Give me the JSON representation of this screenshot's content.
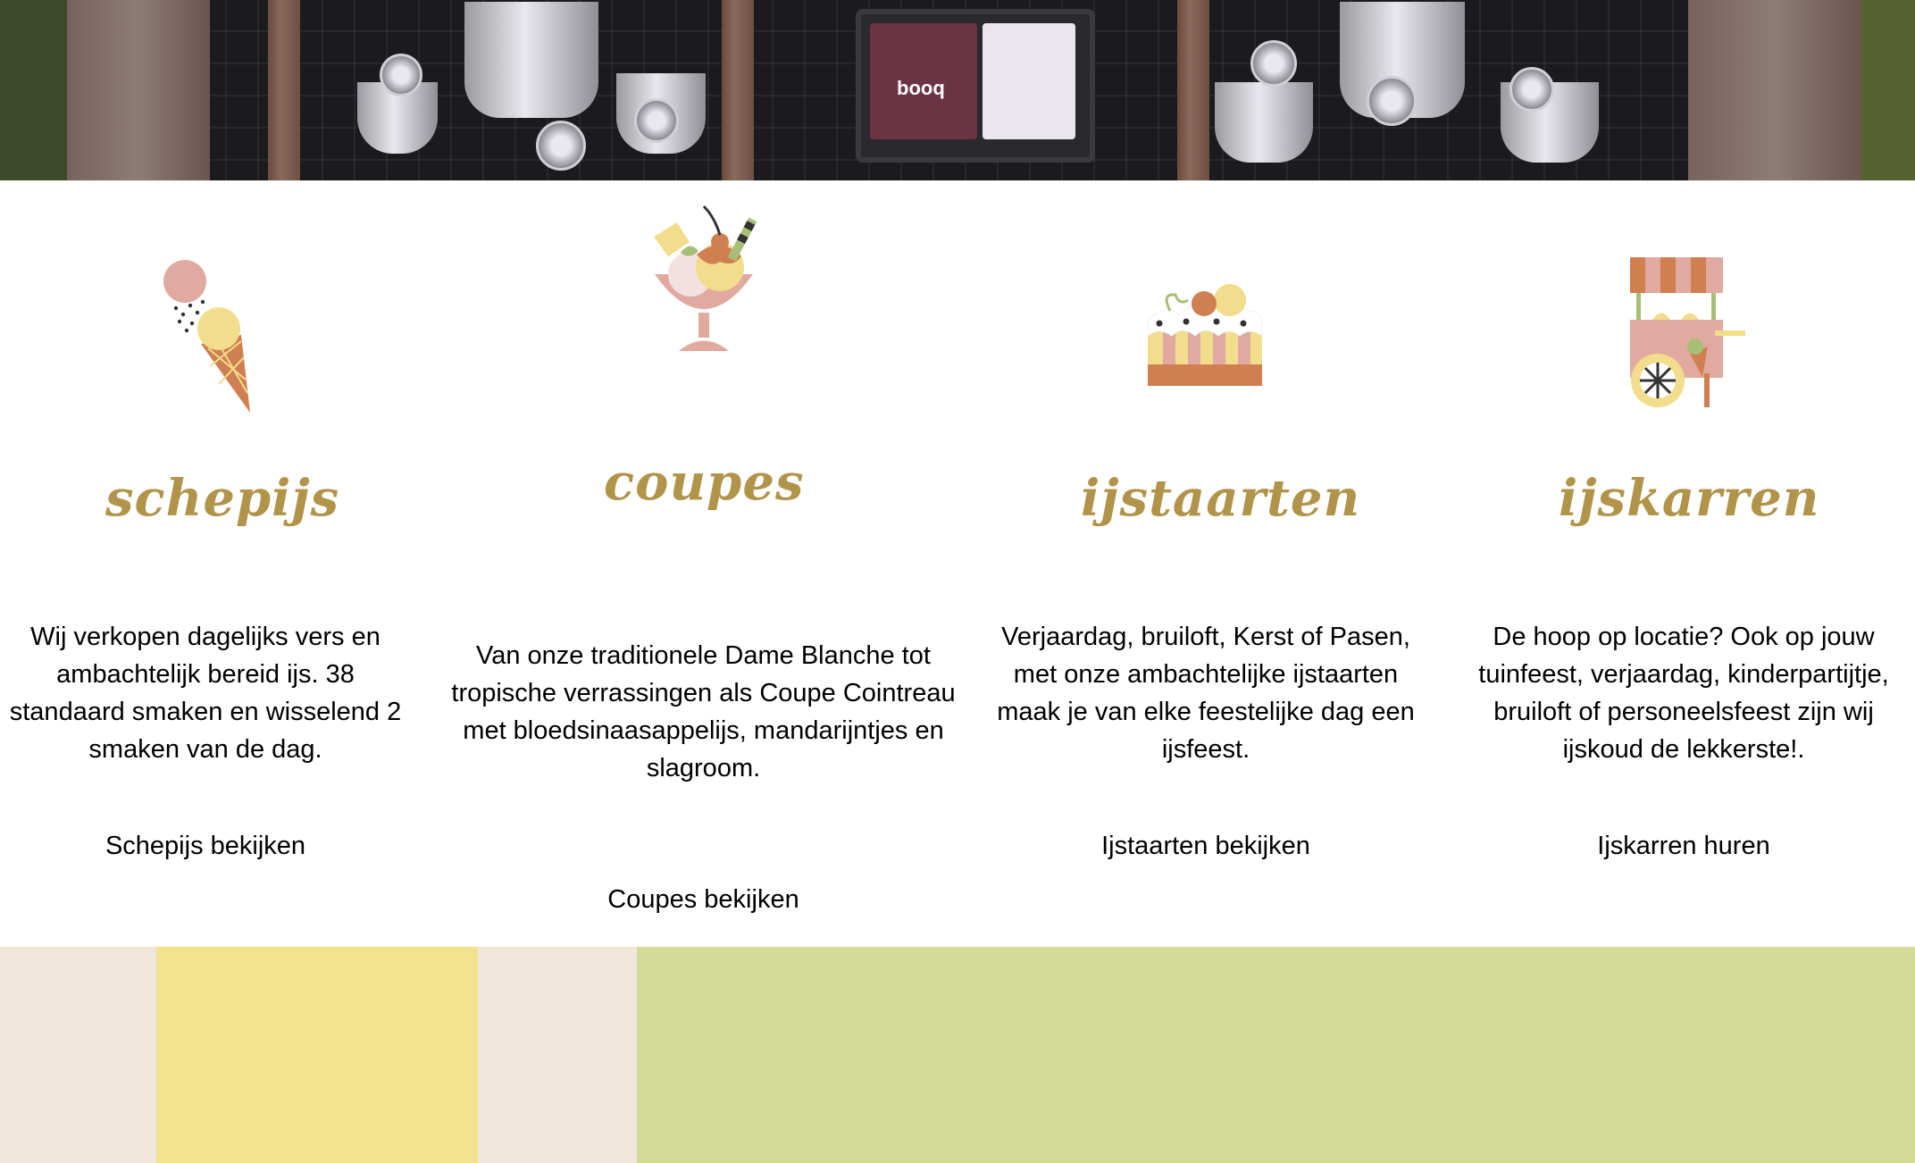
{
  "hero": {
    "screen_brand": "booq"
  },
  "columns": [
    {
      "icon": "ice-cream-cone-icon",
      "title": "schepijs",
      "description": "Wij verkopen dagelijks vers en ambachtelijk bereid ijs. 38 standaard smaken en wisselend 2 smaken van de dag.",
      "link": "Schepijs bekijken"
    },
    {
      "icon": "sundae-cup-icon",
      "title": "coupes",
      "description": "Van onze traditionele Dame Blanche tot tropische verrassingen als Coupe Cointreau met bloedsinaasappelijs, mandarijntjes en slagroom.",
      "link": "Coupes bekijken"
    },
    {
      "icon": "ice-cake-icon",
      "title": "ijstaarten",
      "description": "Verjaardag, bruiloft, Kerst of Pasen, met onze ambachtelijke ijstaarten maak je van elke feestelijke dag een ijsfeest.",
      "link": "Ijstaarten bekijken"
    },
    {
      "icon": "ice-cream-cart-icon",
      "title": "ijskarren",
      "description": "De hoop op locatie? Ook op jouw tuinfeest, verjaardag, kinderpartijtje, bruiloft of personeelsfeest zijn wij ijskoud de lekkerste!.",
      "link": "Ijskarren huren"
    }
  ],
  "colors": {
    "title_gold": "#b1944a",
    "band_cream": "#f0e6da",
    "band_yellow": "#f3e38f",
    "band_green": "#d4db9a",
    "icon_pink": "#e0aaa0",
    "icon_yellow": "#f1dd8b",
    "icon_orange": "#d07f51",
    "icon_green": "#a7bf74"
  }
}
